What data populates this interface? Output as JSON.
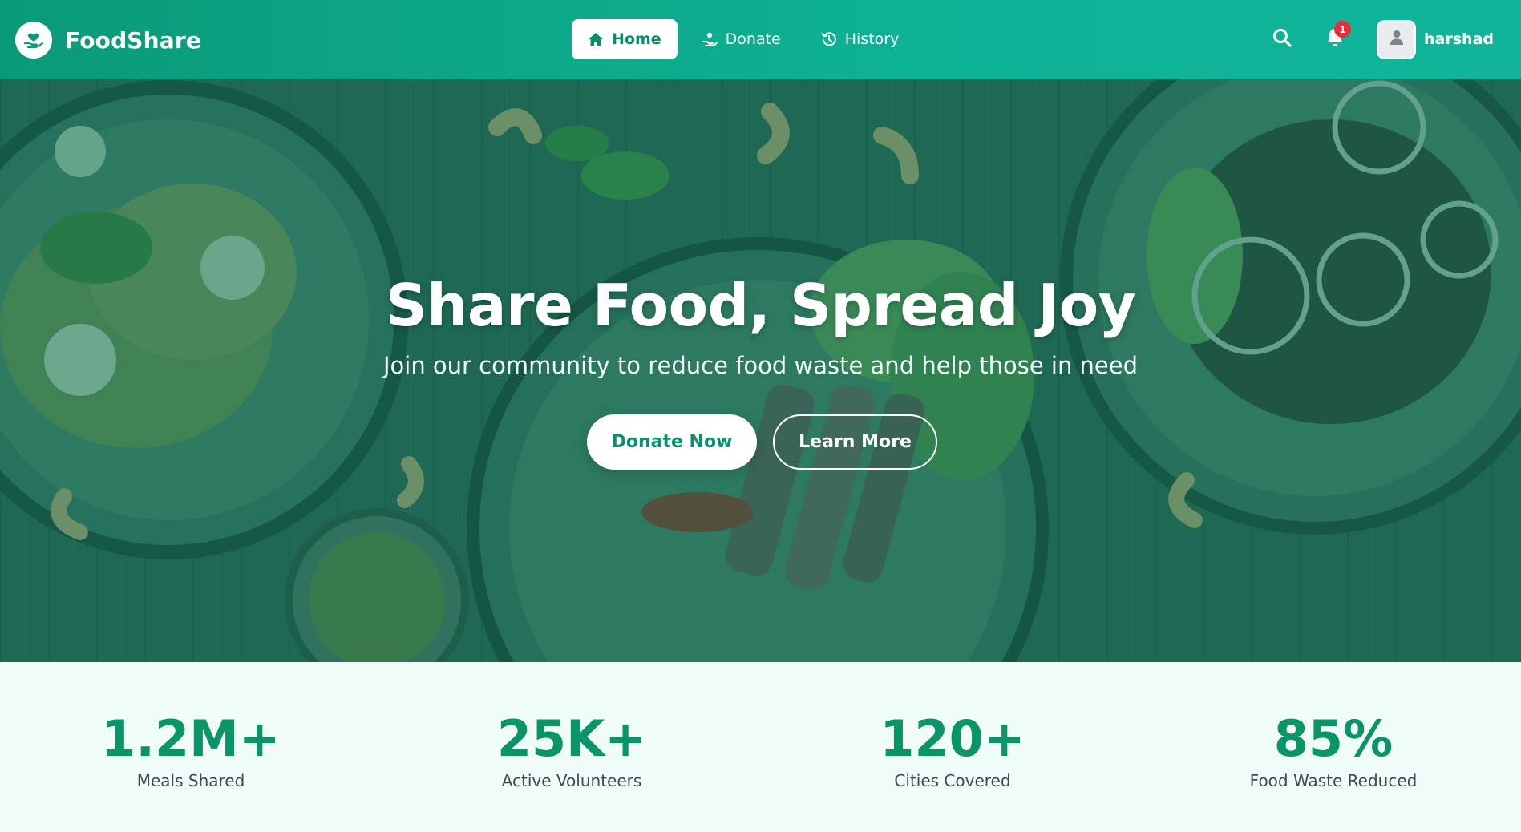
{
  "brand": {
    "name": "FoodShare",
    "logo_icon": "hand-heart-icon"
  },
  "nav": {
    "items": [
      {
        "label": "Home",
        "icon": "home-icon",
        "active": true
      },
      {
        "label": "Donate",
        "icon": "hand-donate-icon",
        "active": false
      },
      {
        "label": "History",
        "icon": "history-icon",
        "active": false
      }
    ]
  },
  "header": {
    "notification_count": "1",
    "username": "harshad"
  },
  "hero": {
    "title": "Share Food, Spread Joy",
    "subtitle": "Join our community to reduce food waste and help those in need",
    "primary_cta": "Donate Now",
    "secondary_cta": "Learn More"
  },
  "stats": [
    {
      "value": "1.2M+",
      "label": "Meals Shared"
    },
    {
      "value": "25K+",
      "label": "Active Volunteers"
    },
    {
      "value": "120+",
      "label": "Cities Covered"
    },
    {
      "value": "85%",
      "label": "Food Waste Reduced"
    }
  ],
  "colors": {
    "brand_green": "#0a9a78",
    "accent_green": "#0a9468",
    "badge_red": "#ef2a3a",
    "stats_bg": "#effcf7"
  }
}
